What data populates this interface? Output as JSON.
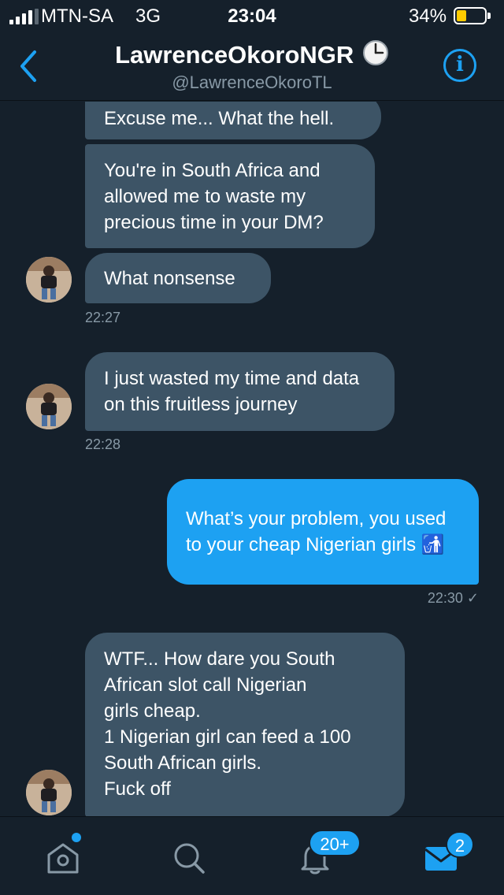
{
  "status_bar": {
    "carrier": "MTN-SA",
    "network": "3G",
    "time": "23:04",
    "battery_percent": "34%",
    "battery_level": 0.34,
    "signal_bars": 4
  },
  "header": {
    "name": "LawrenceOkoroNGR",
    "handle": "@LawrenceOkoroTL",
    "back_icon": "chevron-left-icon",
    "info_icon": "info-icon",
    "info_glyph": "i",
    "accent": "#1da1f2"
  },
  "messages": [
    {
      "direction": "in",
      "text": "Excuse me... What the hell."
    },
    {
      "direction": "in",
      "text": "You're in South Africa and allowed me to waste my precious time in your DM?"
    },
    {
      "direction": "in",
      "text": "What nonsense",
      "avatar": true
    },
    {
      "timestamp": "22:27"
    },
    {
      "direction": "in",
      "text": "I just wasted my time and data on this fruitless journey",
      "avatar": true
    },
    {
      "timestamp": "22:28"
    },
    {
      "direction": "out",
      "text": "What’s your problem, you used to your cheap Nigerian girls",
      "emoji": "🚮"
    },
    {
      "timestamp": "22:30",
      "read_mark": "✓"
    },
    {
      "direction": "in",
      "lines": [
        "WTF... How dare you South",
        "African slot call Nigerian",
        "girls cheap.",
        "1 Nigerian girl can feed a 100",
        "South African girls.",
        "Fuck off"
      ],
      "avatar": true
    }
  ],
  "tab_bar": {
    "home": {
      "icon": "home-icon",
      "has_dot": true
    },
    "search": {
      "icon": "search-icon"
    },
    "notifications": {
      "icon": "bell-icon",
      "badge": "20+"
    },
    "messages": {
      "icon": "mail-icon",
      "badge": "2",
      "active": true
    }
  },
  "colors": {
    "background": "#15202b",
    "incoming_bubble": "#3d5466",
    "outgoing_bubble": "#1da1f2",
    "secondary_text": "#8899a6",
    "battery": "#ffcc00"
  }
}
